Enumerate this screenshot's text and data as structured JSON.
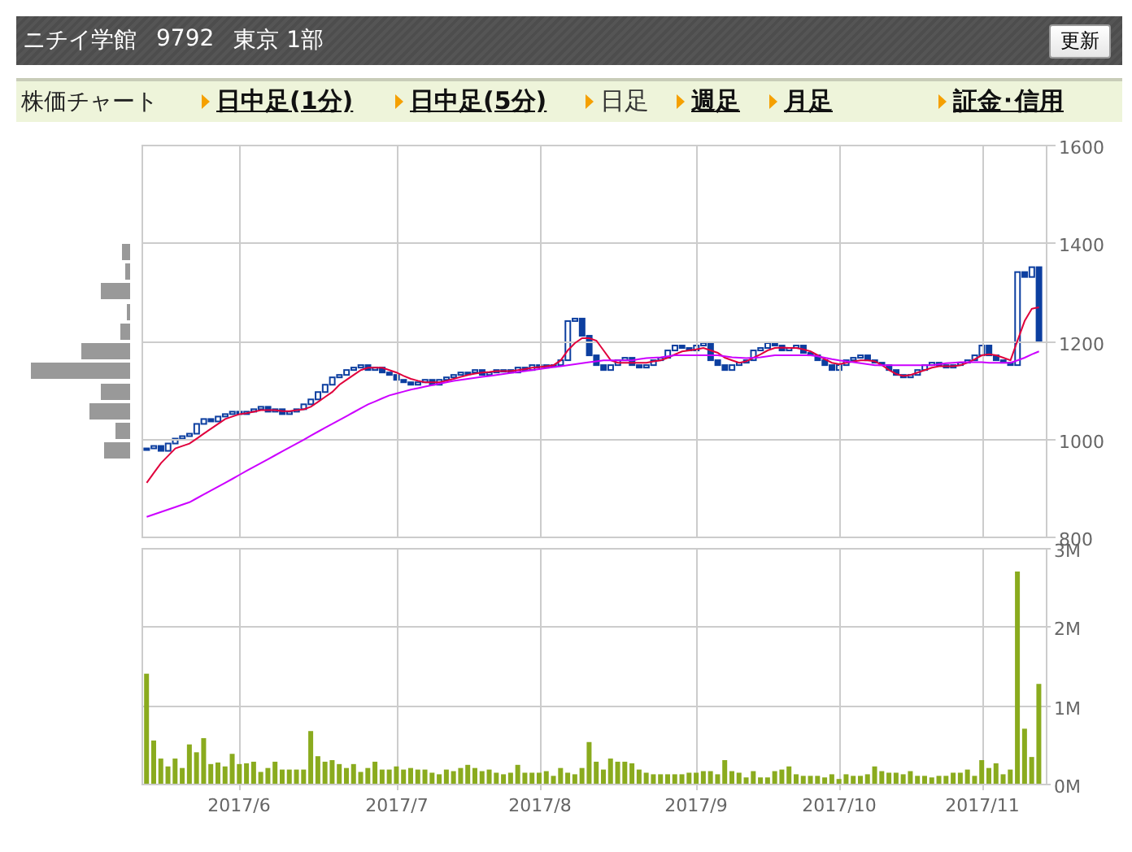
{
  "header": {
    "title": "ニチイ学館",
    "code": "9792",
    "market": "東京 1部",
    "refresh_button": "更新"
  },
  "nav": {
    "label": "株価チャート",
    "items": [
      {
        "label": "日中足(1分)",
        "selected": false
      },
      {
        "label": "日中足(5分)",
        "selected": false
      },
      {
        "label": "日足",
        "selected": true
      },
      {
        "label": "週足",
        "selected": false
      },
      {
        "label": "月足",
        "selected": false
      },
      {
        "label": "証金･信用",
        "selected": false
      }
    ]
  },
  "price_chart": {
    "chart_data": {
      "type": "line",
      "grid": true,
      "ylim": [
        800,
        1600
      ],
      "yticks": [
        800,
        1000,
        1200,
        1400,
        1600
      ],
      "series": [
        {
          "color": "#e0003c",
          "values": [
            910,
            930,
            950,
            965,
            980,
            985,
            990,
            1000,
            1010,
            1020,
            1030,
            1040,
            1045,
            1050,
            1052,
            1055,
            1058,
            1058,
            1058,
            1056,
            1056,
            1058,
            1060,
            1065,
            1075,
            1085,
            1095,
            1110,
            1120,
            1130,
            1140,
            1145,
            1145,
            1145,
            1140,
            1135,
            1128,
            1122,
            1118,
            1115,
            1115,
            1115,
            1118,
            1122,
            1126,
            1130,
            1133,
            1135,
            1136,
            1138,
            1138,
            1138,
            1140,
            1142,
            1145,
            1146,
            1148,
            1150,
            1160,
            1180,
            1195,
            1205,
            1205,
            1200,
            1180,
            1160,
            1155,
            1155,
            1155,
            1155,
            1155,
            1158,
            1160,
            1165,
            1172,
            1178,
            1180,
            1182,
            1185,
            1180,
            1175,
            1165,
            1160,
            1155,
            1158,
            1165,
            1172,
            1180,
            1185,
            1186,
            1185,
            1185,
            1182,
            1178,
            1170,
            1162,
            1155,
            1152,
            1155,
            1158,
            1160,
            1160,
            1158,
            1150,
            1140,
            1132,
            1128,
            1130,
            1135,
            1140,
            1145,
            1148,
            1148,
            1148,
            1150,
            1155,
            1162,
            1170,
            1172,
            1170,
            1165,
            1160,
            1200,
            1240,
            1265,
            1268
          ]
        },
        {
          "color": "#cc00ff",
          "values": [
            840,
            845,
            850,
            855,
            860,
            865,
            870,
            878,
            886,
            894,
            902,
            910,
            918,
            926,
            934,
            942,
            950,
            958,
            966,
            974,
            982,
            990,
            998,
            1006,
            1014,
            1022,
            1030,
            1038,
            1046,
            1054,
            1062,
            1070,
            1076,
            1082,
            1088,
            1092,
            1096,
            1100,
            1103,
            1106,
            1109,
            1112,
            1115,
            1118,
            1120,
            1122,
            1124,
            1126,
            1128,
            1130,
            1132,
            1134,
            1136,
            1138,
            1140,
            1142,
            1144,
            1146,
            1148,
            1150,
            1152,
            1154,
            1156,
            1158,
            1160,
            1160,
            1160,
            1160,
            1160,
            1162,
            1164,
            1165,
            1166,
            1168,
            1170,
            1170,
            1170,
            1170,
            1170,
            1170,
            1170,
            1168,
            1166,
            1165,
            1164,
            1165,
            1166,
            1168,
            1170,
            1170,
            1170,
            1170,
            1170,
            1170,
            1168,
            1165,
            1162,
            1160,
            1158,
            1156,
            1154,
            1152,
            1150,
            1150,
            1150,
            1150,
            1150,
            1150,
            1150,
            1150,
            1150,
            1152,
            1154,
            1155,
            1156,
            1156,
            1156,
            1156,
            1155,
            1155,
            1155,
            1155,
            1160,
            1165,
            1172,
            1178
          ]
        }
      ]
    }
  },
  "volume_chart": {
    "month_labels": [
      "2017/6",
      "2017/7",
      "2017/8",
      "2017/9",
      "2017/10",
      "2017/11"
    ],
    "chart_data": {
      "type": "bar",
      "grid": true,
      "ylim": [
        0,
        3
      ],
      "yticks": [
        {
          "value": 0,
          "label": "0M"
        },
        {
          "value": 1,
          "label": "1M"
        },
        {
          "value": 2,
          "label": "2M"
        },
        {
          "value": 3,
          "label": "3M"
        }
      ],
      "series": [
        {
          "color": "#8aab1e",
          "values": [
            1.4,
            0.55,
            0.32,
            0.22,
            0.32,
            0.2,
            0.5,
            0.4,
            0.58,
            0.25,
            0.27,
            0.22,
            0.38,
            0.25,
            0.26,
            0.28,
            0.15,
            0.2,
            0.28,
            0.18,
            0.18,
            0.18,
            0.18,
            0.67,
            0.35,
            0.28,
            0.3,
            0.25,
            0.2,
            0.25,
            0.15,
            0.2,
            0.28,
            0.18,
            0.18,
            0.22,
            0.18,
            0.2,
            0.18,
            0.18,
            0.14,
            0.12,
            0.18,
            0.16,
            0.2,
            0.24,
            0.2,
            0.16,
            0.18,
            0.14,
            0.12,
            0.14,
            0.24,
            0.14,
            0.14,
            0.14,
            0.16,
            0.1,
            0.2,
            0.14,
            0.12,
            0.2,
            0.53,
            0.28,
            0.18,
            0.32,
            0.28,
            0.28,
            0.26,
            0.18,
            0.14,
            0.12,
            0.12,
            0.12,
            0.12,
            0.12,
            0.14,
            0.14,
            0.16,
            0.16,
            0.12,
            0.3,
            0.16,
            0.14,
            0.08,
            0.16,
            0.08,
            0.08,
            0.16,
            0.18,
            0.22,
            0.12,
            0.1,
            0.1,
            0.1,
            0.08,
            0.12,
            0.06,
            0.12,
            0.1,
            0.1,
            0.12,
            0.22,
            0.16,
            0.14,
            0.14,
            0.12,
            0.16,
            0.1,
            0.1,
            0.08,
            0.1,
            0.1,
            0.14,
            0.14,
            0.18,
            0.1,
            0.3,
            0.2,
            0.26,
            0.12,
            0.18,
            2.7,
            0.7,
            0.34,
            1.27
          ]
        }
      ]
    }
  }
}
